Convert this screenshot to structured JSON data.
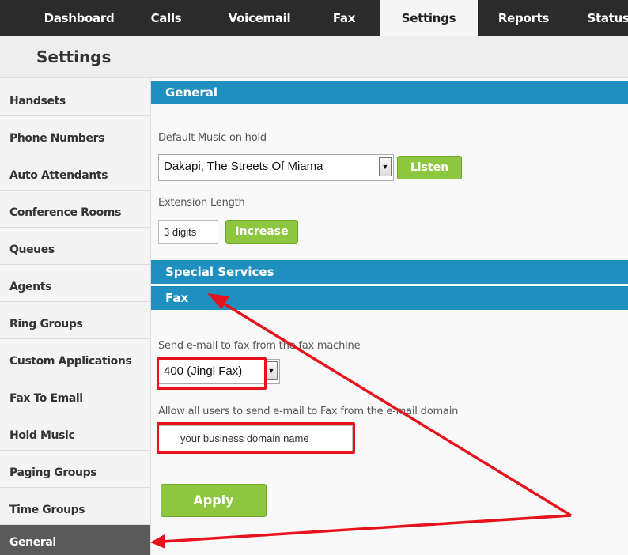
{
  "topnav": {
    "tabs": [
      {
        "label": "Dashboard"
      },
      {
        "label": "Calls"
      },
      {
        "label": "Voicemail"
      },
      {
        "label": "Fax"
      },
      {
        "label": "Settings",
        "active": true
      },
      {
        "label": "Reports"
      },
      {
        "label": "Status"
      }
    ]
  },
  "header": {
    "title": "Settings"
  },
  "sidebar": {
    "items": [
      {
        "label": "Handsets"
      },
      {
        "label": "Phone Numbers"
      },
      {
        "label": "Auto Attendants"
      },
      {
        "label": "Conference Rooms"
      },
      {
        "label": "Queues"
      },
      {
        "label": "Agents"
      },
      {
        "label": "Ring Groups"
      },
      {
        "label": "Custom Applications"
      },
      {
        "label": "Fax To Email"
      },
      {
        "label": "Hold Music"
      },
      {
        "label": "Paging Groups"
      },
      {
        "label": "Time Groups"
      },
      {
        "label": "General",
        "active": true
      }
    ]
  },
  "general": {
    "section_title": "General",
    "music_label": "Default Music on hold",
    "music_value": "Dakapi, The Streets Of Miama",
    "listen_label": "Listen",
    "ext_label": "Extension Length",
    "ext_value": "3 digits",
    "increase_label": "Increase"
  },
  "special": {
    "section_title": "Special Services"
  },
  "fax": {
    "section_title": "Fax",
    "send_label": "Send e-mail to fax from the fax machine",
    "send_value": "400 (Jingl Fax)",
    "allow_label": "Allow all users to send e-mail to Fax from the e-mail domain",
    "domain_value": "your business domain name"
  },
  "apply_label": "Apply",
  "colors": {
    "accent": "#1f8fbf",
    "green": "#8dc63f",
    "annotation": "#e8121c",
    "nav": "#2b2b2b"
  }
}
